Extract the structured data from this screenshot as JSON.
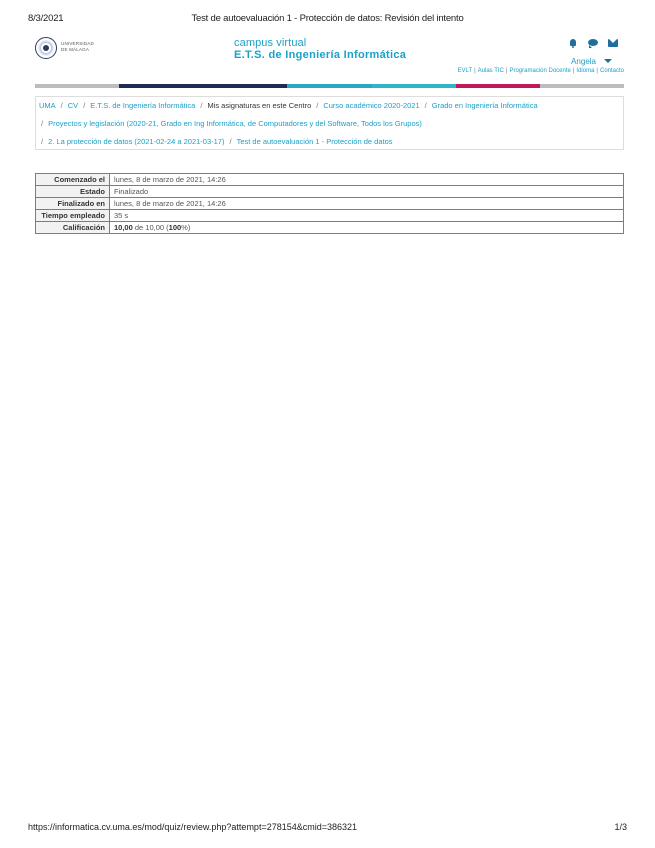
{
  "print": {
    "date": "8/3/2021",
    "title": "Test de autoevaluación 1 - Protección de datos: Revisión del intento",
    "url": "https://informatica.cv.uma.es/mod/quiz/review.php?attempt=278154&cmid=386321",
    "page": "1/3"
  },
  "header": {
    "university": [
      "Universidad",
      "de Málaga"
    ],
    "brand_line1": "campus virtual",
    "brand_line2": "E.T.S. de Ingeniería Informática",
    "user": "Angela",
    "icons": [
      "bell-icon",
      "chat-icon",
      "mail-icon",
      "caret-icon"
    ]
  },
  "toplinks": [
    "EVLT",
    "Aulas TIC",
    "Programación Docente",
    "Idioma",
    "Contacto"
  ],
  "colors": {
    "accent": "#1aa1c9",
    "bar": [
      "#bdbdbd",
      "#1e2c55",
      "#1e2c55",
      "#2aa6c9",
      "#2fb5c9",
      "#c2185b",
      "#bdbdbd"
    ]
  },
  "breadcrumb": {
    "row1": [
      "UMA",
      "CV",
      "E.T.S. de Ingeniería Informática",
      "Mis asignaturas en este Centro",
      "Curso académico 2020-2021",
      "Grado en Ingeniería Informática"
    ],
    "row2": [
      "Proyectos y legislación (2020-21, Grado en Ing Informática, de Computadores y del Software, Todos los Grupos)"
    ],
    "row3": [
      "2. La protección de datos (2021-02-24 a 2021-03-17)",
      "Test de autoevaluación 1 - Protección de datos"
    ]
  },
  "summary": {
    "rows": [
      {
        "label": "Comenzado el",
        "value": "lunes, 8 de marzo de 2021, 14:26"
      },
      {
        "label": "Estado",
        "value": "Finalizado"
      },
      {
        "label": "Finalizado en",
        "value": "lunes, 8 de marzo de 2021, 14:26"
      },
      {
        "label": "Tiempo empleado",
        "value": "35 s"
      }
    ],
    "grade_label": "Calificación",
    "grade_score": "10,00",
    "grade_of": "de 10,00 (",
    "grade_percent": "100",
    "grade_tail": "%)"
  }
}
